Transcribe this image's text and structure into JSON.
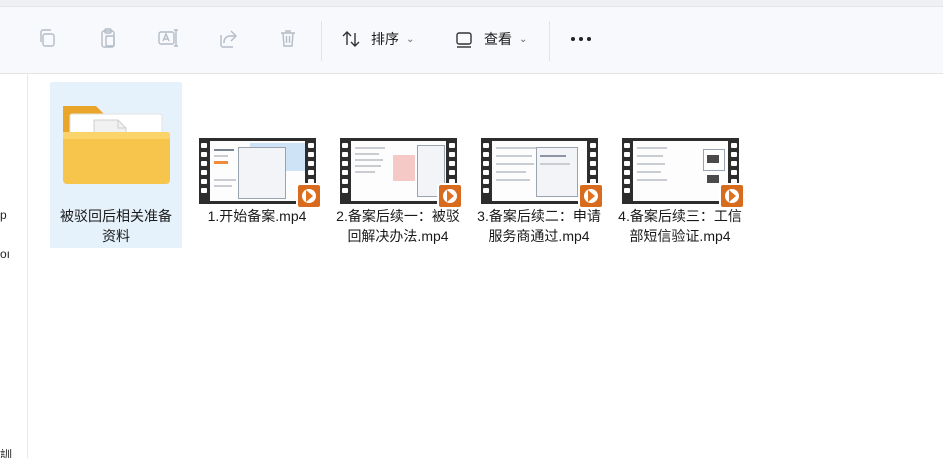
{
  "toolbar": {
    "icons": [
      "copy-icon",
      "paste-icon",
      "rename-icon",
      "share-icon",
      "delete-icon"
    ],
    "sort_label": "排序",
    "view_label": "查看",
    "more_icon": "more-icon"
  },
  "left_pane": {
    "fragments": [
      "p",
      "oı",
      "訓"
    ]
  },
  "files": [
    {
      "name": "被驳回后相关准备资料",
      "type": "folder",
      "selected": true
    },
    {
      "name": "1.开始备案.mp4",
      "type": "video",
      "selected": false
    },
    {
      "name": "2.备案后续一：被驳回解决办法.mp4",
      "type": "video",
      "selected": false
    },
    {
      "name": "3.备案后续二：申请服务商通过.mp4",
      "type": "video",
      "selected": false
    },
    {
      "name": "4.备案后续三：工信部短信验证.mp4",
      "type": "video",
      "selected": false
    }
  ],
  "colors": {
    "selection": "#e5f1fb",
    "folder": "#f5c04a",
    "play_badge": "#d96b1f"
  }
}
